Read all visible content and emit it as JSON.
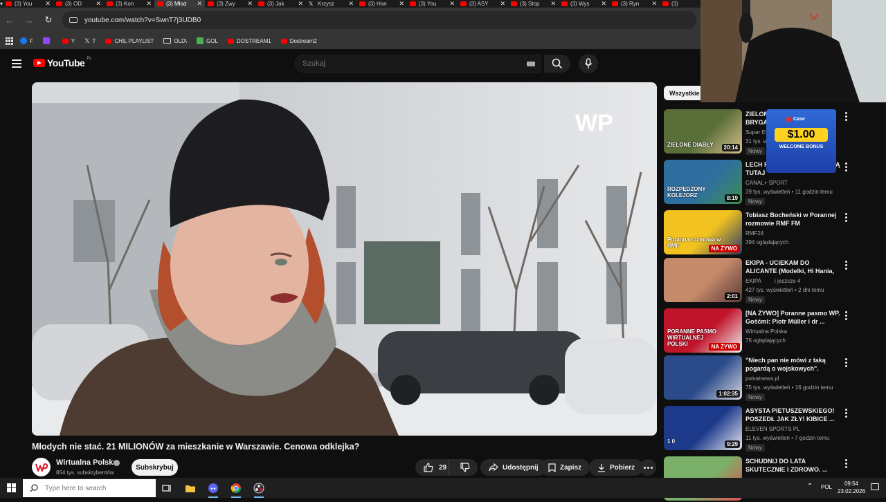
{
  "browser": {
    "tabs": [
      {
        "label": "(3) You",
        "type": "yt"
      },
      {
        "label": "(3) OD",
        "type": "yt"
      },
      {
        "label": "(3) Kon",
        "type": "yt"
      },
      {
        "label": "(3) Młod",
        "type": "yt",
        "active": true
      },
      {
        "label": "(3) Zwy",
        "type": "yt"
      },
      {
        "label": "(3) Jak",
        "type": "yt"
      },
      {
        "label": "Krzysz",
        "type": "x"
      },
      {
        "label": "(3) Han",
        "type": "yt"
      },
      {
        "label": "(3) You",
        "type": "yt"
      },
      {
        "label": "(3) ASY",
        "type": "yt"
      },
      {
        "label": "(3) Stop",
        "type": "yt"
      },
      {
        "label": "(3) Wys",
        "type": "yt"
      },
      {
        "label": "(3) Ryn",
        "type": "yt"
      },
      {
        "label": "(3)",
        "type": "yt"
      }
    ],
    "url": "youtube.com/watch?v=SwnT7j3UDB0",
    "bookmarks": [
      {
        "label": "F",
        "icon": "facebook-icon"
      },
      {
        "label": "",
        "icon": "twitch-icon"
      },
      {
        "label": "Y",
        "icon": "youtube-icon"
      },
      {
        "label": "T",
        "icon": "x-icon"
      },
      {
        "label": "CHIL PLAYLIST",
        "icon": "youtube-icon"
      },
      {
        "label": "OLD\\",
        "icon": "folder-icon"
      },
      {
        "label": "GOL",
        "icon": "g-icon"
      },
      {
        "label": "DOSTREAM1",
        "icon": "youtube-icon"
      },
      {
        "label": "Dostream2",
        "icon": "youtube-icon"
      }
    ]
  },
  "youtube": {
    "logo_text": "YouTube",
    "region": "PL",
    "search_placeholder": "Szukaj",
    "video": {
      "watermark": "WP",
      "title": "Młodych nie stać. 21 MILIONÓW za mieszkanie w Warszawie. Cenowa odklejka?",
      "channel": "Wirtualna Polska",
      "subscribers": "854 tys. subskrybentów",
      "subscribe_label": "Subskrybuj",
      "likes": "29",
      "share_label": "Udostępnij",
      "save_label": "Zapisz",
      "download_label": "Pobierz"
    },
    "filter_chip": "Wszystkie",
    "recommendations": [
      {
        "title": "ZIELONE DIABŁY Z 21. BRYGADY",
        "channel": "Super Ex",
        "meta": "31 tys. w",
        "badge": "Nowy",
        "duration": "20:14",
        "thumb_text": "ZIELONE DIABŁY",
        "colors": [
          "#5a6e3a",
          "#d8c08a"
        ]
      },
      {
        "title": "LECH PO POZNAŃ... OBJĄŁ BĄ TUTAJ",
        "channel": "CANAL+ SPORT",
        "meta": "39 tys. wyświetleń • 11 godzin temu",
        "badge": "Nowy",
        "duration": "8:19",
        "thumb_text": "ROZPĘDZONY KOLEJORZ",
        "colors": [
          "#2f6fa0",
          "#3e8e4e"
        ]
      },
      {
        "title": "Tobiasz Bocheński w Porannej rozmowie RMF FM",
        "channel": "RMF24",
        "meta": "394 oglądających",
        "live": "NA ŻYWO",
        "thumb_text": "Poranna rozmowa w RMF",
        "colors": [
          "#f2c320",
          "#2a3a6a"
        ]
      },
      {
        "title": "EKIPA - UCIEKAM DO ALICANTE (Modelki, Hi Hania, Bartek ...",
        "channel": "EKIPA",
        "channel_extra": "i jeszcze 4",
        "meta": "427 tys. wyświetleń • 2 dni temu",
        "badge": "Nowy",
        "duration": "2:01",
        "thumb_text": "",
        "colors": [
          "#c48a6a",
          "#5a3a3a"
        ]
      },
      {
        "title": "[NA ŻYWO] Poranne pasmo WP. Gośćmi: Piotr Müller i dr ...",
        "channel": "Wirtualna Polska",
        "meta": "76 oglądających",
        "live": "NA ŻYWO",
        "thumb_text": "PORANNE PASMO WIRTUALNEJ POLSKI",
        "colors": [
          "#c0142a",
          "#f2f2f2"
        ]
      },
      {
        "title": "\"Niech pan nie mówi z taką pogardą o wojskowych\". Gorąc...",
        "channel": "polsatnews.pl",
        "meta": "75 tys. wyświetleń • 16 godzin temu",
        "badge": "Nowy",
        "duration": "1:02:35",
        "thumb_text": "",
        "colors": [
          "#2a4a8a",
          "#d7d9e0"
        ]
      },
      {
        "title": "ASYSTA PIETUSZEWSKIEGO! POSZEDŁ JAK ZŁY! KIBICE ...",
        "channel": "ELEVEN SPORTS PL",
        "meta": "11 tys. wyświetleń • 7 godzin temu",
        "badge": "Nowy",
        "duration": "9:29",
        "thumb_text": "1 0",
        "colors": [
          "#1d3a8a",
          "#e7e7f0"
        ]
      },
      {
        "title": "SCHUDNIJ DO LATA SKUTECZNIE I ZDROWO. ...",
        "channel": "",
        "meta": "",
        "thumb_text": "",
        "colors": [
          "#7bb06a",
          "#e05050"
        ]
      }
    ]
  },
  "overlay": {
    "promo_brand": "Case",
    "promo_amount": "$1.00",
    "promo_text": "WELCOME BONUS"
  },
  "taskbar": {
    "search_placeholder": "Type here to search",
    "lang": "POL",
    "time": "09:54",
    "date": "23.02.2026"
  }
}
